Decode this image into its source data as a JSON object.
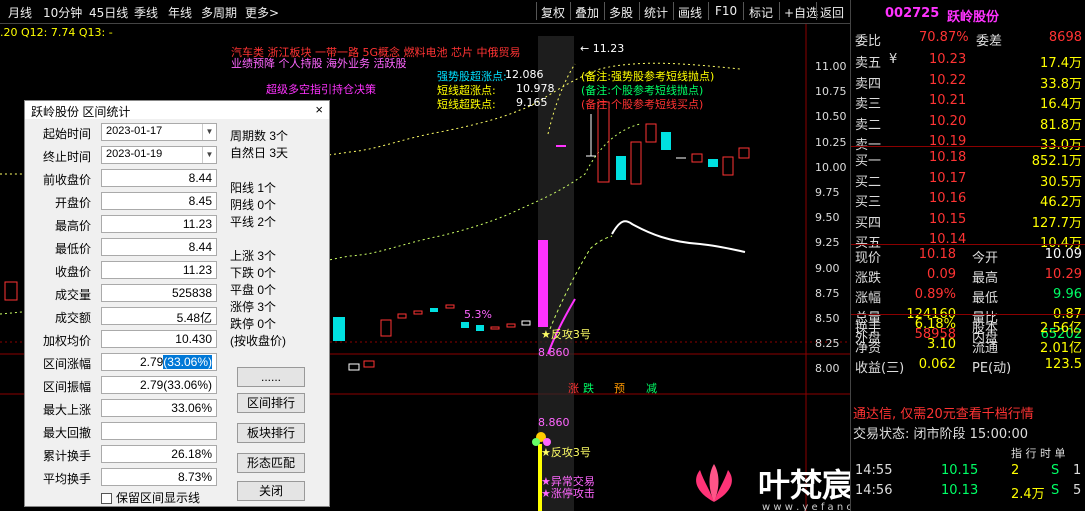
{
  "toolbar": {
    "left": [
      "月线",
      "10分钟",
      "45日线",
      "季线",
      "年线",
      "多周期",
      "更多>"
    ],
    "right": [
      "复权",
      "叠加",
      "多股",
      "统计",
      "画线",
      "F10",
      "标记",
      "+自选",
      "返回"
    ]
  },
  "chart": {
    "indicator_header": ".20  Q12: 7.74  Q13: -",
    "concepts_line1": "汽车类    浙江板块   一带一路  5G概念  燃料电池  芯片  中俄贸易",
    "concepts_line2": "业绩预降  个人持股  海外业务  活跃股",
    "signal_title": "超级多空指引持仓决策",
    "signals": [
      {
        "label": "强势股超涨点:",
        "value": "12.086",
        "note": "(备注:强势股参考短线抛点)"
      },
      {
        "label": "短线超涨点:",
        "value": "10.978",
        "note": "(备注:个股参考短线抛点)"
      },
      {
        "label": "短线超跌点:",
        "value": "9.165",
        "note": "(备注:个股参考短线买点)"
      }
    ],
    "high_mark": "← 11.23",
    "pct_label": "5.3%",
    "fangong_label": "★反攻3号",
    "price_8860": "8.860",
    "tags": [
      "涨",
      "跌",
      "预",
      "减"
    ],
    "lower_price": "8.860",
    "lower_fangong": "★反攻3号",
    "lower_abnormal": "★异常交易",
    "lower_zhangting": "★涨停攻击",
    "y_ticks": [
      "11.00",
      "10.75",
      "10.50",
      "10.25",
      "10.00",
      "9.75",
      "9.50",
      "9.25",
      "9.00",
      "8.75",
      "8.50",
      "8.25",
      "8.00"
    ],
    "watermark_text": "叶梵宸指标公式网",
    "watermark_url": "w w w . y e f a n c h e n . c o m"
  },
  "dialog": {
    "title": "跃岭股份 区间统计",
    "close": "×",
    "fields": [
      {
        "label": "起始时间",
        "value": "2023-01-17"
      },
      {
        "label": "终止时间",
        "value": "2023-01-19"
      },
      {
        "label": "前收盘价",
        "value": "8.44"
      },
      {
        "label": "开盘价",
        "value": "8.45"
      },
      {
        "label": "最高价",
        "value": "11.23"
      },
      {
        "label": "最低价",
        "value": "8.44"
      },
      {
        "label": "收盘价",
        "value": "11.23"
      },
      {
        "label": "成交量",
        "value": "525838"
      },
      {
        "label": "成交额",
        "value": "5.48亿"
      },
      {
        "label": "加权均价",
        "value": "10.430"
      },
      {
        "label": "区间涨幅",
        "value": "2.79",
        "value_sel": "(33.06%)"
      },
      {
        "label": "区间振幅",
        "value": "2.79(33.06%)"
      },
      {
        "label": "最大上涨",
        "value": "33.06%"
      },
      {
        "label": "最大回撤",
        "value": ""
      },
      {
        "label": "累计换手",
        "value": "26.18%"
      },
      {
        "label": "平均换手",
        "value": "8.73%"
      }
    ],
    "stats": [
      "周期数 3个",
      "自然日 3天",
      "阳线 1个",
      "阴线 0个",
      "平线 2个",
      "上涨 3个",
      "下跌 0个",
      "平盘 0个",
      "涨停 3个",
      "跌停 0个",
      "(按收盘价)"
    ],
    "buttons": [
      "......",
      "区间排行",
      "板块排行",
      "形态匹配",
      "关闭"
    ],
    "checkbox_label": "保留区间显示线"
  },
  "quote": {
    "code": "002725",
    "name": "跃岭股份",
    "weibi_label": "委比",
    "weibi": "70.87%",
    "weicha_label": "委差",
    "weicha": "8698",
    "asks": [
      {
        "label": "卖五",
        "flag": "¥",
        "price": "10.23",
        "vol": "17.4万"
      },
      {
        "label": "卖四",
        "flag": "",
        "price": "10.22",
        "vol": "33.8万"
      },
      {
        "label": "卖三",
        "flag": "",
        "price": "10.21",
        "vol": "16.4万"
      },
      {
        "label": "卖二",
        "flag": "",
        "price": "10.20",
        "vol": "81.8万"
      },
      {
        "label": "卖一",
        "flag": "",
        "price": "10.19",
        "vol": "33.0万"
      }
    ],
    "bids": [
      {
        "label": "买一",
        "price": "10.18",
        "vol": "852.1万"
      },
      {
        "label": "买二",
        "price": "10.17",
        "vol": "30.5万"
      },
      {
        "label": "买三",
        "price": "10.16",
        "vol": "46.2万"
      },
      {
        "label": "买四",
        "price": "10.15",
        "vol": "127.7万"
      },
      {
        "label": "买五",
        "price": "10.14",
        "vol": "10.4万"
      }
    ],
    "stats": [
      {
        "l1": "现价",
        "v1": "10.18",
        "l2": "今开",
        "v2": "10.09"
      },
      {
        "l1": "涨跌",
        "v1": "0.09",
        "l2": "最高",
        "v2": "10.29"
      },
      {
        "l1": "涨幅",
        "v1": "0.89%",
        "l2": "最低",
        "v2": "9.96"
      },
      {
        "l1": "总量",
        "v1": "124160",
        "l2": "量比",
        "v2": "0.87"
      },
      {
        "l1": "外盘",
        "v1": "58958",
        "l2": "内盘",
        "v2": "65202"
      }
    ],
    "stats2": [
      {
        "l1": "换手",
        "v1": "6.18%",
        "l2": "股本",
        "v2": "2.56亿"
      },
      {
        "l1": "净资",
        "v1": "3.10",
        "l2": "流通",
        "v2": "2.01亿"
      },
      {
        "l1": "收益(三)",
        "v1": "0.062",
        "l2": "PE(动)",
        "v2": "123.5"
      }
    ],
    "ad": "通达信, 仅需20元查看千档行情",
    "status": "交易状态: 闭市阶段 15:00:00",
    "ticks": [
      {
        "time": "14:55",
        "price": "10.15",
        "vol": "2",
        "bs": "S",
        "cnt": "1"
      },
      {
        "time": "14:56",
        "price": "10.13",
        "vol": "2.4万",
        "bs": "S",
        "cnt": "5"
      }
    ],
    "tick_header": "指 行 时 单"
  },
  "colors": {
    "up": "#ff3333",
    "down": "#00e0e0",
    "yellow": "#ffff00",
    "magenta": "#ff33ff",
    "grid": "#8b0000",
    "bg": "#000000"
  }
}
